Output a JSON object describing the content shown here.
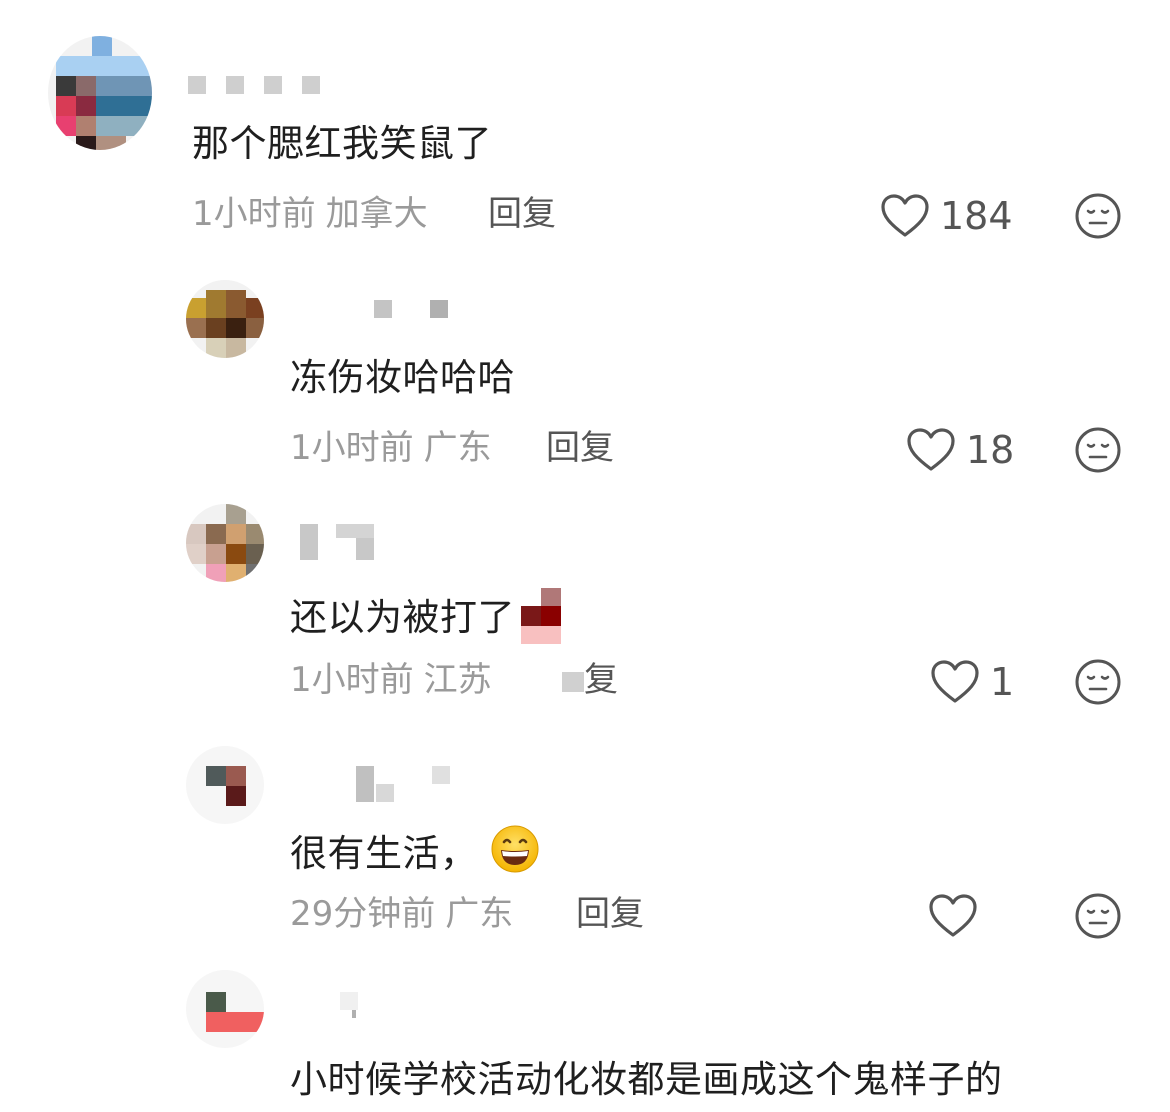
{
  "comments": [
    {
      "text": "那个腮红我笑鼠了",
      "time": "1小时前",
      "location": "加拿大",
      "reply_label": "回复",
      "likes": "184"
    },
    {
      "text": "冻伤妆哈哈哈",
      "time": "1小时前",
      "location": "广东",
      "reply_label": "回复",
      "likes": "18"
    },
    {
      "text": "还以为被打了",
      "time": "1小时前",
      "location": "江苏",
      "reply_label": "复",
      "likes": "1"
    },
    {
      "text": "很有生活，",
      "time": "29分钟前",
      "location": "广东",
      "reply_label": "回复",
      "likes": ""
    },
    {
      "text": "小时候学校活动化妆都是画成这个鬼样子的"
    }
  ],
  "icons": {
    "like": "heart-outline-icon",
    "dislike": "neutral-face-icon",
    "emoji": "grinning-face-emoji"
  },
  "colors": {
    "text": "#1f1f1f",
    "meta": "#9a9a9a",
    "reply": "#555555",
    "icon": "#555555"
  }
}
